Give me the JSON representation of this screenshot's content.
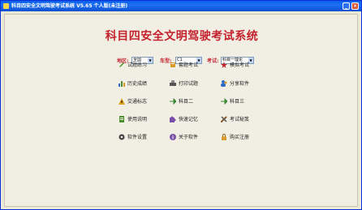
{
  "window": {
    "title": "科目四安全文明驾驶考试系统 V5.65 个人版(未注册)",
    "min_glyph": "_",
    "close_glyph": "×"
  },
  "app": {
    "title": "科目四安全文明驾驶考试系统"
  },
  "filters": {
    "region_label": "地区:",
    "region_value": "全国",
    "vehicle_label": "车型:",
    "vehicle_value": "C1",
    "exam_label": "考试:",
    "exam_value": "科目一理论"
  },
  "menu": [
    {
      "label": "试题练习",
      "icon": "pencil-icon",
      "color": "#4A8F2A"
    },
    {
      "label": "套题考试",
      "icon": "book-icon",
      "color": "#D79A2B"
    },
    {
      "label": "模拟考试",
      "icon": "star-icon",
      "color": "#C4222E"
    },
    {
      "label": "历史成绩",
      "icon": "bar-chart-icon",
      "color": "#2F6BC4"
    },
    {
      "label": "打印试题",
      "icon": "printer-icon",
      "color": "#555555"
    },
    {
      "label": "分享软件",
      "icon": "users-icon",
      "color": "#2F6BC4"
    },
    {
      "label": "交通标志",
      "icon": "warning-icon",
      "color": "#E0A020"
    },
    {
      "label": "科目二",
      "icon": "arrow-icon",
      "color": "#3A8A3A"
    },
    {
      "label": "科目三",
      "icon": "arrow-icon",
      "color": "#3A8A3A"
    },
    {
      "label": "使用说明",
      "icon": "document-icon",
      "color": "#4A8F2A"
    },
    {
      "label": "快速记忆",
      "icon": "puzzle-icon",
      "color": "#7A4FA8"
    },
    {
      "label": "考试秘笈",
      "icon": "tools-icon",
      "color": "#8A5A2A"
    },
    {
      "label": "软件设置",
      "icon": "gear-icon",
      "color": "#444444"
    },
    {
      "label": "关于软件",
      "icon": "info-icon",
      "color": "#7A4FA8"
    },
    {
      "label": "购买注册",
      "icon": "lock-icon",
      "color": "#D79A2B"
    }
  ]
}
